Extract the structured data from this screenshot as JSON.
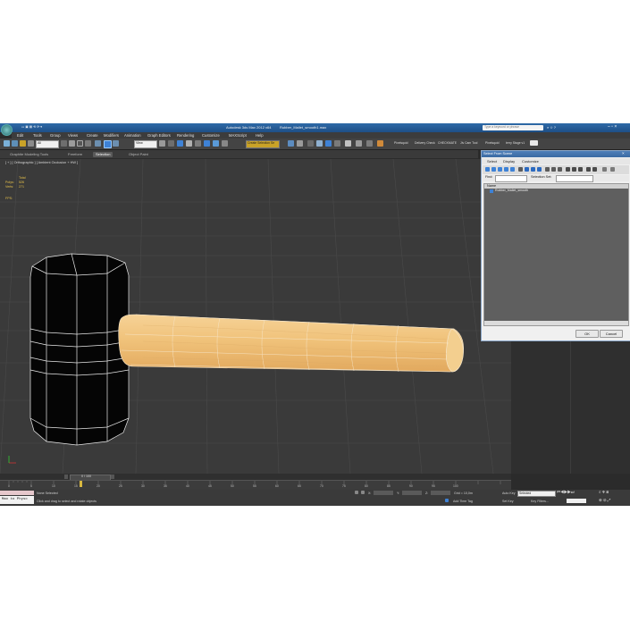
{
  "window": {
    "title_app": "Autodesk 3ds Max 2012 x64",
    "title_file": "Rubber_Mallet_smooth1.max",
    "search_placeholder": "Type a keyword or phrase"
  },
  "menu": [
    "Edit",
    "Tools",
    "Group",
    "Views",
    "Create",
    "Modifiers",
    "Animation",
    "Graph Editors",
    "Rendering",
    "Customize",
    "MAXScript",
    "Help"
  ],
  "toolbar": {
    "selection_filter": "All",
    "reference_coord": "View",
    "named_selection": "Create Selection Se",
    "ext_labels": [
      "Pixelsquid",
      "Delivery Check",
      "CHECKMATE",
      "Jiv Cam Tool",
      "Pixelsquid",
      "terry Stage v1"
    ]
  },
  "ribbon": {
    "tabs": [
      "Graphite Modeling Tools",
      "Freeform",
      "Selection",
      "Object Paint"
    ],
    "active_tab": "Selection"
  },
  "viewport": {
    "label": "[ + ] [ Orthographic ] [ Ambient Occlusion + HW ]",
    "stats": {
      "header": "Total",
      "polys_label": "Polys:",
      "polys_value": "526",
      "verts_label": "Verts:",
      "verts_value": "271",
      "fps_label": "FPS:"
    }
  },
  "dialog": {
    "title": "Select From Scene",
    "tabs": [
      "Select",
      "Display",
      "Customize"
    ],
    "find_label": "Find:",
    "selection_set_label": "Selection Set:",
    "column_header": "Name",
    "items": [
      "Rubber_Mallet_smooth"
    ],
    "ok_label": "OK",
    "cancel_label": "Cancel"
  },
  "timeline": {
    "frame_display": "0 / 100",
    "ticks": [
      "0",
      "5",
      "10",
      "15",
      "20",
      "25",
      "30",
      "35",
      "40",
      "45",
      "50",
      "55",
      "60",
      "65",
      "70",
      "75",
      "80",
      "85",
      "90",
      "95",
      "100"
    ]
  },
  "status": {
    "maxscript_text": "Max to Physc",
    "selection_status": "None Selected",
    "prompt": "Click and drag to select and rotate objects",
    "x_label": "X:",
    "y_label": "Y:",
    "z_label": "Z:",
    "grid": "Grid = 10,0m",
    "auto_key": "Auto Key",
    "auto_key_value": "Selected",
    "set_key": "Set Key",
    "key_filters": "Key Filters...",
    "add_time_tag": "Add Time Tag"
  },
  "colors": {
    "accent_title": "#2f6aa8",
    "handle_wood": "#f0c27a",
    "stats_text": "#e8c24a"
  }
}
